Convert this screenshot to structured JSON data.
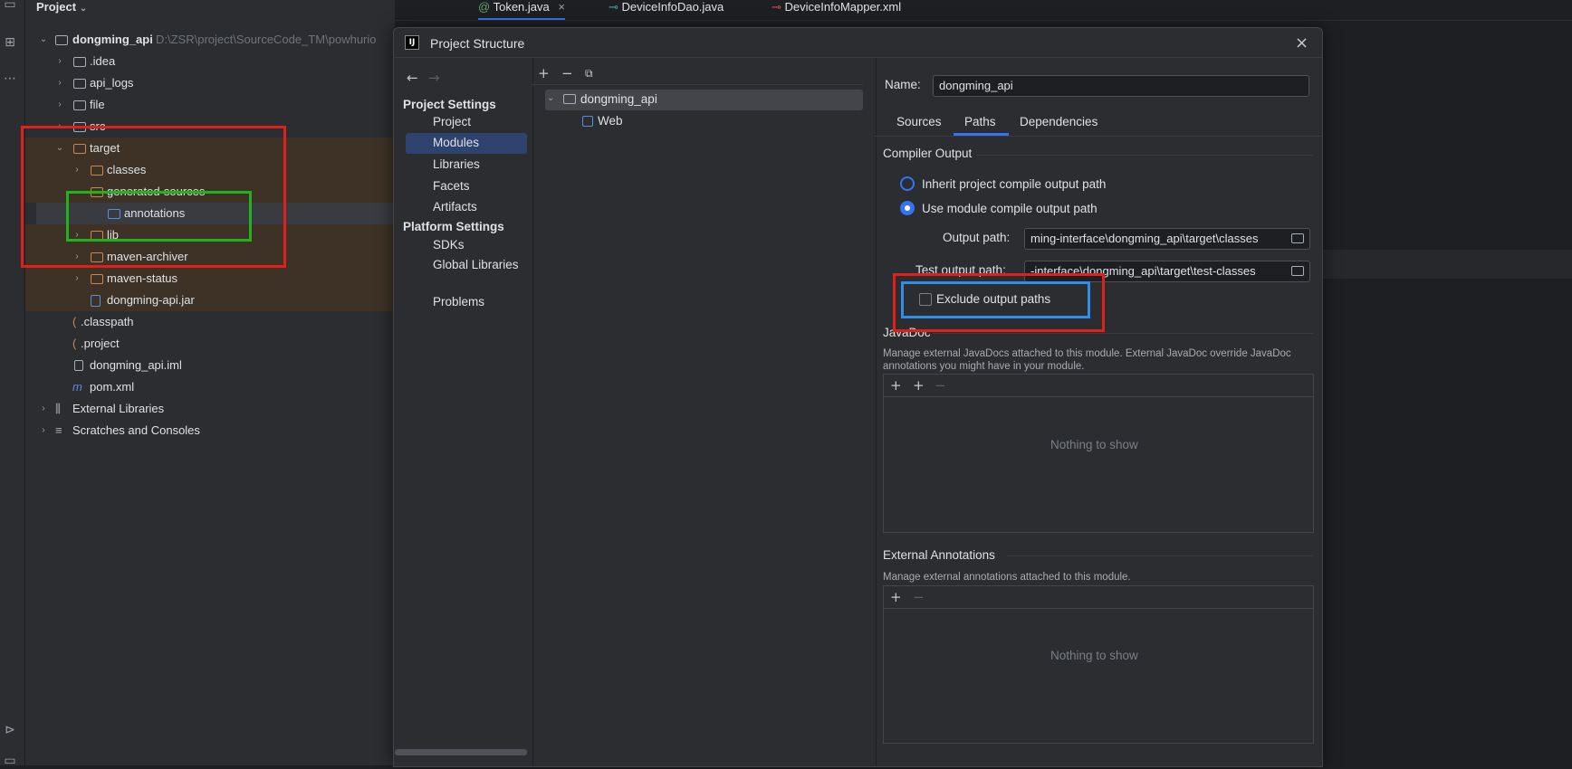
{
  "project_panel": {
    "title": "Project",
    "tree": [
      {
        "label": "dongming_api",
        "hint": "D:\\ZSR\\project\\SourceCode_TM\\powhurio"
      },
      {
        "label": ".idea"
      },
      {
        "label": "api_logs"
      },
      {
        "label": "file"
      },
      {
        "label": "src"
      },
      {
        "label": "target"
      },
      {
        "label": "classes"
      },
      {
        "label": "generated-sources"
      },
      {
        "label": "annotations"
      },
      {
        "label": "lib"
      },
      {
        "label": "maven-archiver"
      },
      {
        "label": "maven-status"
      },
      {
        "label": "dongming-api.jar"
      },
      {
        "label": ".classpath"
      },
      {
        "label": ".project"
      },
      {
        "label": "dongming_api.iml"
      },
      {
        "label": "pom.xml"
      },
      {
        "label": "External Libraries"
      },
      {
        "label": "Scratches and Consoles"
      }
    ]
  },
  "editor_tabs": [
    {
      "label": "Token.java",
      "icon": "@"
    },
    {
      "label": "DeviceInfoDao.java"
    },
    {
      "label": "DeviceInfoMapper.xml"
    }
  ],
  "dialog": {
    "title": "Project Structure",
    "project_settings_heading": "Project Settings",
    "project_settings": [
      "Project",
      "Modules",
      "Libraries",
      "Facets",
      "Artifacts"
    ],
    "platform_settings_heading": "Platform Settings",
    "platform_settings": [
      "SDKs",
      "Global Libraries"
    ],
    "problems": "Problems",
    "module_tree": [
      {
        "label": "dongming_api"
      },
      {
        "label": "Web"
      }
    ],
    "name_label": "Name:",
    "name_value": "dongming_api",
    "tabs": [
      "Sources",
      "Paths",
      "Dependencies"
    ],
    "compiler_output": "Compiler Output",
    "inherit_option": "Inherit project compile output path",
    "use_module_option": "Use module compile output path",
    "output_path_label": "Output path:",
    "output_path_value": "ming-interface\\dongming_api\\target\\classes",
    "test_output_label": "Test output path:",
    "test_output_value": "-interface\\dongming_api\\target\\test-classes",
    "exclude_label": "Exclude output paths",
    "javadoc_heading": "JavaDoc",
    "javadoc_desc_1": "Manage external JavaDocs attached to this module. External JavaDoc override JavaDoc",
    "javadoc_desc_2": "annotations you might have in your module.",
    "nothing_to_show": "Nothing to show",
    "ext_annotations_heading": "External Annotations",
    "ext_annotations_desc": "Manage external annotations attached to this module.",
    "nothing_to_show_2": "Nothing to show"
  },
  "colors": {
    "accent": "#3574f0",
    "annotation_red": "#e0201b",
    "annotation_green": "#22b21c",
    "annotation_blue": "#2f8fe8"
  }
}
